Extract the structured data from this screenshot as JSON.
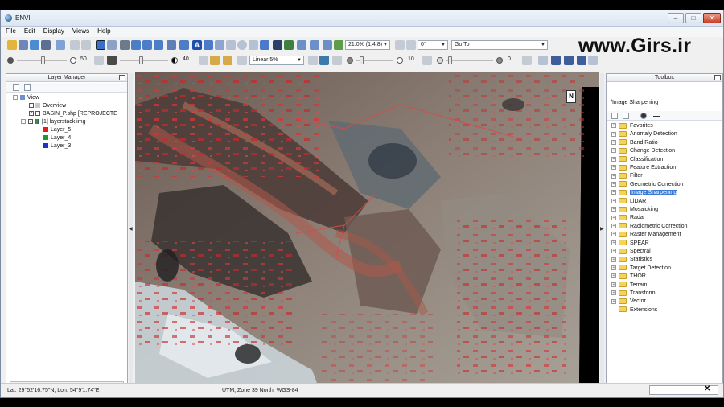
{
  "window": {
    "title": "ENVI",
    "min": "–",
    "max": "□",
    "close": "✕"
  },
  "menu": [
    "File",
    "Edit",
    "Display",
    "Views",
    "Help"
  ],
  "toolbar": {
    "zoom_value": "21.0% (1:4.8)",
    "rotation_value": "0°",
    "goto_placeholder": "Go To",
    "brightness": "50",
    "contrast": "40",
    "stretch": "Linear 5%",
    "sharpen": "10",
    "transparency": "0"
  },
  "watermark": "www.Girs.ir",
  "layer_manager": {
    "title": "Layer Manager",
    "items": [
      {
        "label": "View",
        "level": 0
      },
      {
        "label": "Overview",
        "level": 1
      },
      {
        "label": "BASIN_P.shp [REPROJECTE",
        "level": 1
      },
      {
        "label": "[1] layerstack.img",
        "level": 1
      },
      {
        "label": "Layer_5",
        "level": 2,
        "color": "#e21b1b"
      },
      {
        "label": "Layer_4",
        "level": 2,
        "color": "#1c9a2a"
      },
      {
        "label": "Layer_3",
        "level": 2,
        "color": "#1c33c8"
      }
    ]
  },
  "toolbox": {
    "title": "Toolbox",
    "search_value": "/Image Sharpening",
    "selected": "Image Sharpening",
    "items": [
      "Favorites",
      "Anomaly Detection",
      "Band Ratio",
      "Change Detection",
      "Classification",
      "Feature Extraction",
      "Filter",
      "Geometric Correction",
      "Image Sharpening",
      "LiDAR",
      "Mosaicking",
      "Radar",
      "Radiometric Correction",
      "Raster Management",
      "SPEAR",
      "Spectral",
      "Statistics",
      "Target Detection",
      "THOR",
      "Terrain",
      "Transform",
      "Vector",
      "Extensions"
    ]
  },
  "map": {
    "north_label": "N"
  },
  "status": {
    "coords": "Lat: 29°52'16.75\"N, Lon: 54°9'1.74\"E",
    "projection": "UTM, Zone 39 North, WGS-84",
    "close": "✕"
  },
  "colors": {
    "folder": "#f3d35c",
    "selection": "#3a7bd5",
    "terrain_red": "#c8282c"
  }
}
